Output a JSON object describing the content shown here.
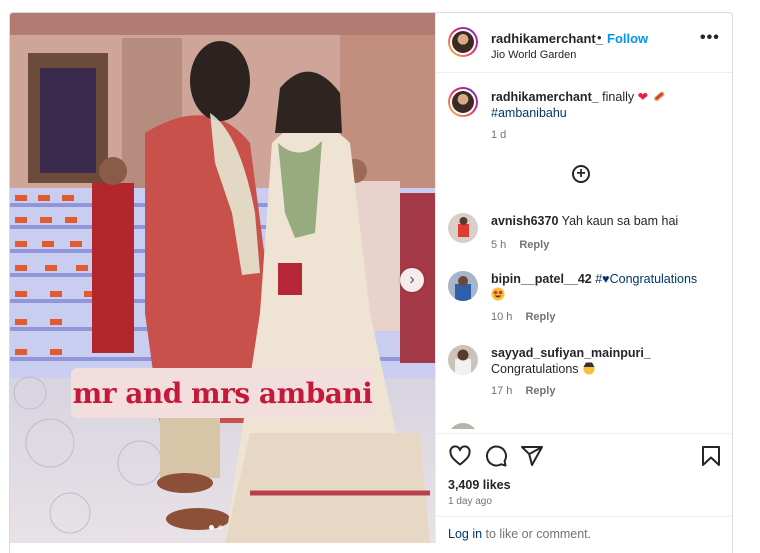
{
  "post": {
    "username": "radhikamerchant_",
    "separator": "•",
    "follow_label": "Follow",
    "location": "Jio World Garden",
    "more_label": "•••",
    "image_caption_overlay": "mr and mrs ambani",
    "carousel_next_glyph": "›",
    "carousel_dots": 2,
    "carousel_active_index": 0
  },
  "caption": {
    "username": "radhikamerchant_",
    "text": "finally",
    "emojis": [
      "red-heart",
      "hot-dog"
    ],
    "hashtag": "#ambanibahu",
    "time": "1 d"
  },
  "load_more_glyph": "+",
  "comments": [
    {
      "username": "avnish6370",
      "text": "Yah kaun sa bam hai",
      "time": "5 h",
      "reply": "Reply",
      "avatar_color": "#d8d0c8"
    },
    {
      "username": "bipin__patel__42",
      "text": "#♥Congratulations",
      "text_is_hashtag": true,
      "emoji": "star-struck",
      "time": "10 h",
      "reply": "Reply",
      "avatar_color": "#a7b4c9"
    },
    {
      "username": "sayyad_sufiyan_mainpuri_",
      "text": "Congratulations",
      "emoji": "hat-face",
      "time": "17 h",
      "reply": "Reply",
      "avatar_color": "#c9c3bc"
    }
  ],
  "actions": {
    "icons": [
      "heart-icon",
      "comment-icon",
      "share-icon",
      "bookmark-icon"
    ],
    "likes": "3,409 likes",
    "time_ago": "1 day ago",
    "login_link": "Log in",
    "login_suffix": " to like or comment."
  },
  "colors": {
    "accent_blue": "#0095f6",
    "link_dark": "#00376b",
    "overlay_text": "#c4193a",
    "overlay_bg": "#f3dede"
  }
}
